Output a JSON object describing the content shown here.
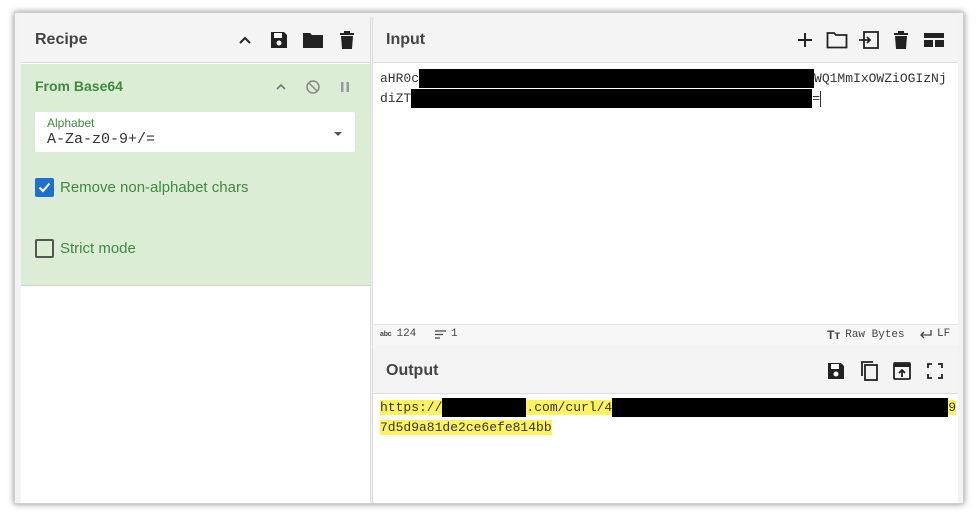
{
  "recipe": {
    "title": "Recipe",
    "icons": [
      "chevron-up-icon",
      "save-icon",
      "folder-icon",
      "trash-icon"
    ]
  },
  "operation": {
    "name": "From Base64",
    "alphabet_label": "Alphabet",
    "alphabet_value": "A-Za-z0-9+/=",
    "remove_non_alphabet_label": "Remove non-alphabet chars",
    "remove_non_alphabet_checked": true,
    "strict_mode_label": "Strict mode",
    "strict_mode_checked": false,
    "accent_color": "#3f8a3f",
    "card_color": "#dcedd6"
  },
  "input": {
    "title": "Input",
    "line1_start": "aHR0c",
    "line1_end": "WQ1MmIxOWZiOGIzNj",
    "line2_start": "diZT",
    "line2_end": "=",
    "icons": [
      "plus-icon",
      "folder-icon",
      "import-icon",
      "trash-icon",
      "layout-icon"
    ],
    "status": {
      "length": "124",
      "lines": "1",
      "encoding": "Raw Bytes",
      "eol": "LF"
    }
  },
  "output": {
    "title": "Output",
    "line1_start": "https://",
    "line1_mid": ".com/curl/4",
    "line1_end": "9",
    "line2": "7d5d9a81de2ce6efe814bb",
    "icons": [
      "save-icon",
      "copy-icon",
      "replace-input-icon",
      "maximize-icon"
    ],
    "highlight_color": "#fff25c"
  }
}
